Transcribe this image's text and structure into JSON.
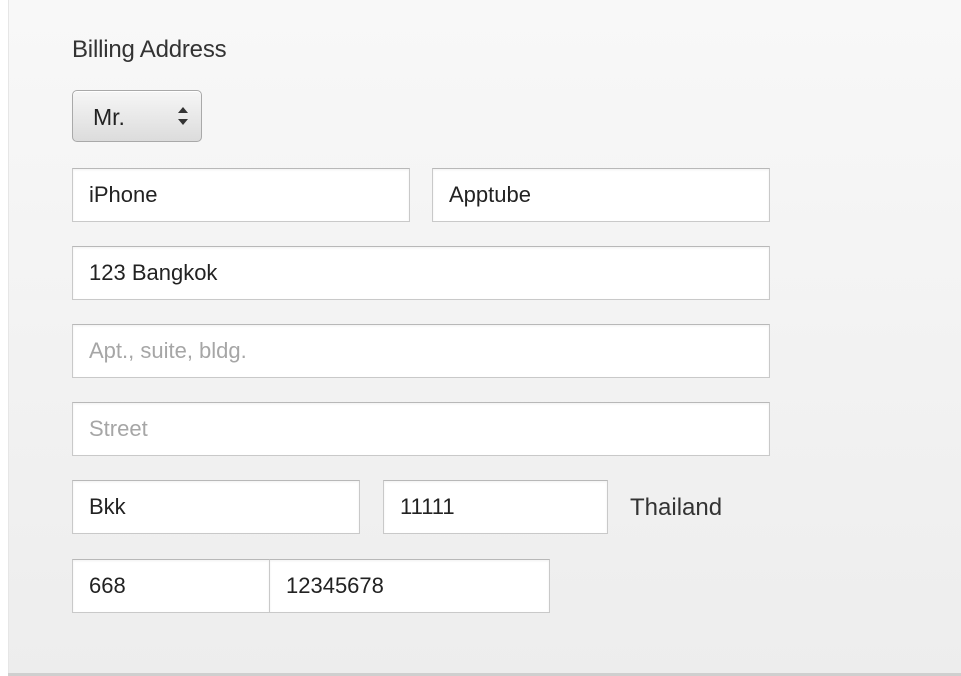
{
  "billing": {
    "title": "Billing Address",
    "salutation": {
      "selected": "Mr."
    },
    "first_name": {
      "value": "iPhone"
    },
    "last_name": {
      "value": "Apptube"
    },
    "address_line1": {
      "value": "123 Bangkok"
    },
    "address_line2": {
      "value": "",
      "placeholder": "Apt., suite, bldg."
    },
    "street": {
      "value": "",
      "placeholder": "Street"
    },
    "city": {
      "value": "Bkk"
    },
    "postal_code": {
      "value": "11111"
    },
    "country": "Thailand",
    "phone_area": {
      "value": "668"
    },
    "phone_number": {
      "value": "12345678"
    }
  },
  "icons": {
    "select_arrows": "up-down-chevron-icon"
  },
  "colors": {
    "panel_background": "#f2f2f2",
    "field_border": "#c9c9c9",
    "text": "#222222",
    "placeholder": "#a6a6a6"
  }
}
